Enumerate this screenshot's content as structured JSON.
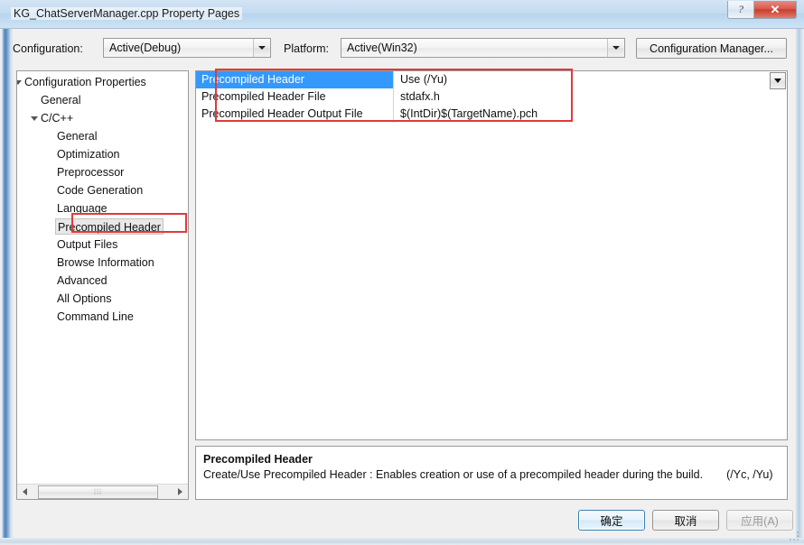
{
  "window": {
    "title": "KG_ChatServerManager.cpp Property Pages",
    "help_button": "?",
    "close_button": "✕"
  },
  "toolbar": {
    "configuration_label": "Configuration:",
    "configuration_value": "Active(Debug)",
    "platform_label": "Platform:",
    "platform_value": "Active(Win32)",
    "configuration_manager_label": "Configuration Manager..."
  },
  "tree": {
    "items": [
      {
        "label": "Configuration Properties",
        "indent": 0,
        "arrow": true,
        "selected": false
      },
      {
        "label": "General",
        "indent": 1,
        "arrow": false,
        "selected": false
      },
      {
        "label": "C/C++",
        "indent": 1,
        "arrow": true,
        "selected": false
      },
      {
        "label": "General",
        "indent": 2,
        "arrow": false,
        "selected": false
      },
      {
        "label": "Optimization",
        "indent": 2,
        "arrow": false,
        "selected": false
      },
      {
        "label": "Preprocessor",
        "indent": 2,
        "arrow": false,
        "selected": false
      },
      {
        "label": "Code Generation",
        "indent": 2,
        "arrow": false,
        "selected": false
      },
      {
        "label": "Language",
        "indent": 2,
        "arrow": false,
        "selected": false
      },
      {
        "label": "Precompiled Header",
        "indent": 2,
        "arrow": false,
        "selected": true
      },
      {
        "label": "Output Files",
        "indent": 2,
        "arrow": false,
        "selected": false
      },
      {
        "label": "Browse Information",
        "indent": 2,
        "arrow": false,
        "selected": false
      },
      {
        "label": "Advanced",
        "indent": 2,
        "arrow": false,
        "selected": false
      },
      {
        "label": "All Options",
        "indent": 2,
        "arrow": false,
        "selected": false
      },
      {
        "label": "Command Line",
        "indent": 2,
        "arrow": false,
        "selected": false
      }
    ],
    "scrollbar": {
      "left_arrow": "◀",
      "right_arrow": "▶",
      "thumb_grip": "⦙⦙⦙"
    }
  },
  "grid": {
    "rows": [
      {
        "name": "Precompiled Header",
        "value": "Use (/Yu)",
        "selected": true
      },
      {
        "name": "Precompiled Header File",
        "value": "stdafx.h",
        "selected": false
      },
      {
        "name": "Precompiled Header Output File",
        "value": "$(IntDir)$(TargetName).pch",
        "selected": false
      }
    ]
  },
  "description": {
    "title": "Precompiled Header",
    "body": "Create/Use Precompiled Header : Enables creation or use of a precompiled header during the build.",
    "flags": "(/Yc, /Yu)"
  },
  "footer": {
    "ok_label": "确定",
    "cancel_label": "取消",
    "apply_label": "应用(A)"
  },
  "annotations": {
    "accent_color": "#e03a3a",
    "selection_color": "#3399ff"
  }
}
